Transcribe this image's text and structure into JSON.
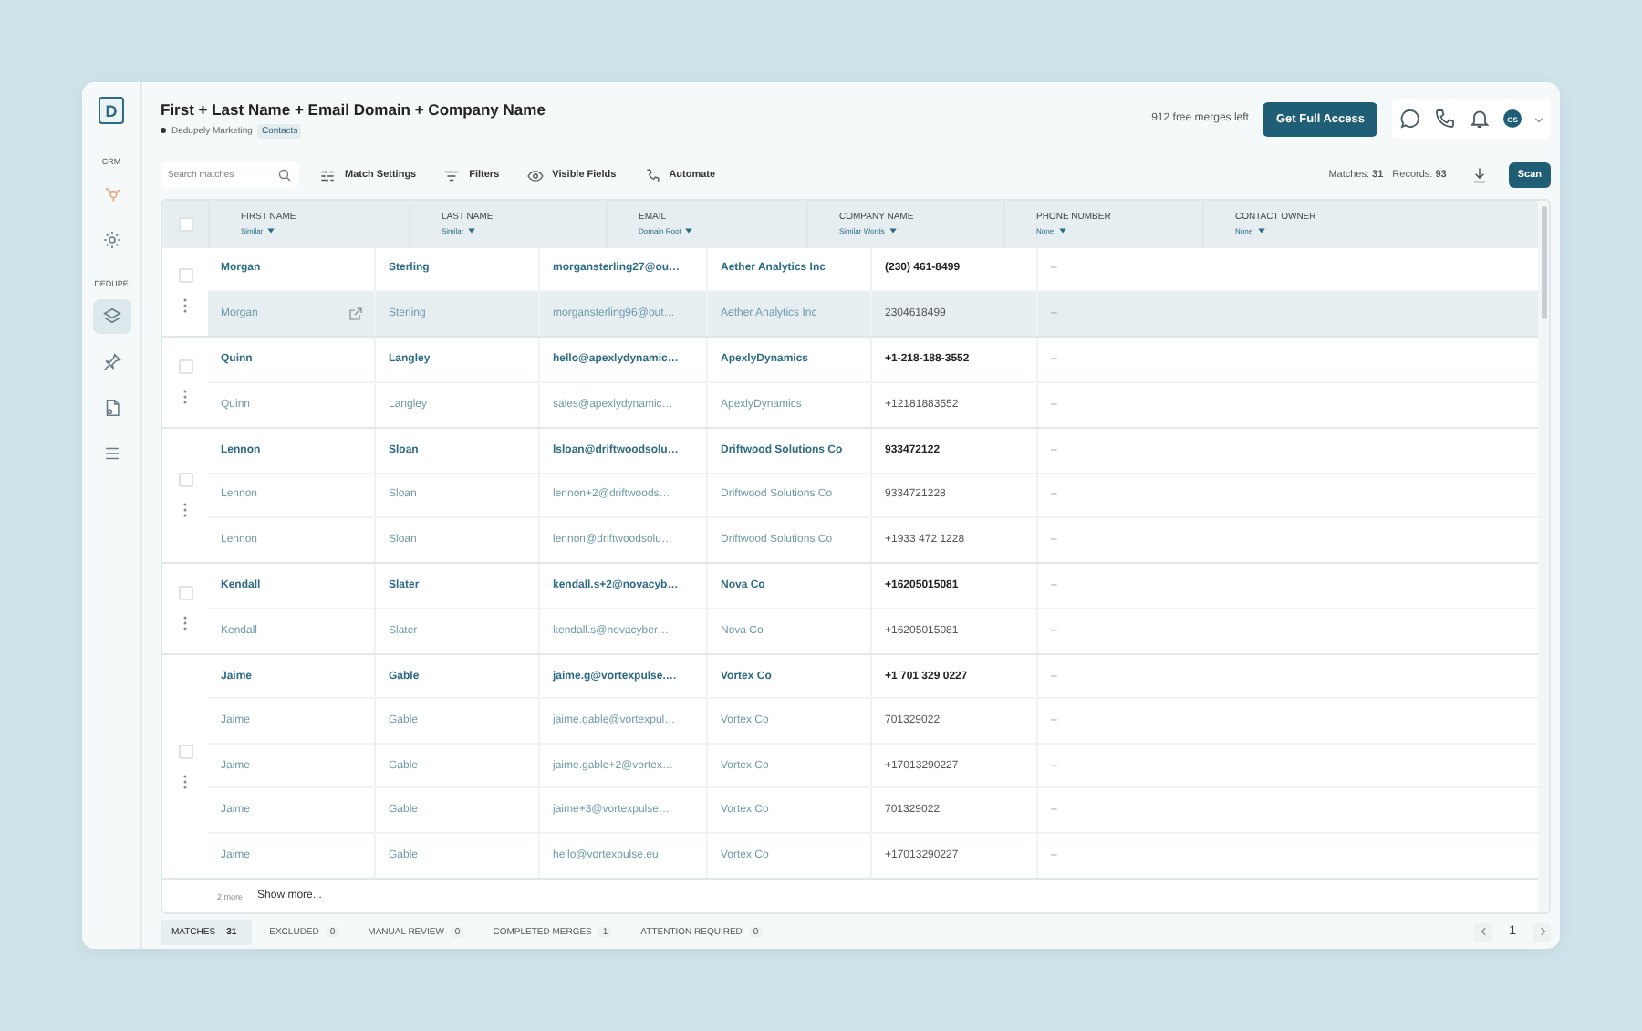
{
  "sidebar": {
    "sections": [
      {
        "label": "CRM",
        "items": [
          {
            "selected": false
          }
        ]
      },
      {
        "items": [
          {
            "selected": false
          }
        ]
      },
      {
        "label": "DEDUPE",
        "items": [
          {
            "selected": true
          },
          {
            "selected": false
          },
          {
            "selected": false
          },
          {
            "selected": false
          }
        ]
      }
    ]
  },
  "header": {
    "logo": "D",
    "title": "First + Last Name + Email Domain + Company Name",
    "account": "Dedupely Marketing",
    "object": "Contacts",
    "free_merges": "912 free merges left",
    "cta": "Get Full Access",
    "avatar": "GS"
  },
  "toolbar": {
    "search": {
      "placeholder": "Search matches"
    },
    "actions": [
      "Match Settings",
      "Filters",
      "Visible Fields",
      "Automate"
    ],
    "matches": "Matches: **31**",
    "records": "Records: **93**",
    "scan": "Scan"
  },
  "table": {
    "select_all_checked": false,
    "columns": [
      {
        "name": "FIRST NAME",
        "filter": "Similar"
      },
      {
        "name": "LAST NAME",
        "filter": "Similar"
      },
      {
        "name": "EMAIL",
        "filter": "Domain Root"
      },
      {
        "name": "COMPANY NAME",
        "filter": "Similar Words"
      },
      {
        "name": "PHONE NUMBER",
        "filter": "None"
      },
      {
        "name": "CONTACT OWNER",
        "filter": "None"
      }
    ],
    "groups": [
      {
        "checked": false,
        "rows": [
          {
            "kind": "primary",
            "hovered": false,
            "cells": [
              "Morgan",
              "Sterling",
              "morgansterling27@ou…",
              "Aether Analytics Inc",
              "(230) 461-8499",
              "–"
            ]
          },
          {
            "kind": "duplicate",
            "hovered": true,
            "cells": [
              "Morgan",
              "Sterling",
              "morgansterling96@out…",
              "Aether Analytics Inc",
              "2304618499",
              "–"
            ]
          }
        ]
      },
      {
        "checked": false,
        "rows": [
          {
            "kind": "primary",
            "hovered": false,
            "cells": [
              "Quinn",
              "Langley",
              "hello@apexlydynamic…",
              "ApexlyDynamics",
              "+1-218-188-3552",
              "–"
            ]
          },
          {
            "kind": "duplicate",
            "hovered": false,
            "cells": [
              "Quinn",
              "Langley",
              "sales@apexlydynamic…",
              "ApexlyDynamics",
              "+12181883552",
              "–"
            ]
          }
        ]
      },
      {
        "checked": false,
        "rows": [
          {
            "kind": "primary",
            "hovered": false,
            "cells": [
              "Lennon",
              "Sloan",
              "lsloan@driftwoodsolu…",
              "Driftwood Solutions Co",
              "933472122",
              "–"
            ]
          },
          {
            "kind": "duplicate",
            "hovered": false,
            "cells": [
              "Lennon",
              "Sloan",
              "lennon+2@driftwoods…",
              "Driftwood Solutions Co",
              "9334721228",
              "–"
            ]
          },
          {
            "kind": "duplicate",
            "hovered": false,
            "cells": [
              "Lennon",
              "Sloan",
              "lennon@driftwoodsolu…",
              "Driftwood Solutions Co",
              "+1933 472 1228",
              "–"
            ]
          }
        ]
      },
      {
        "checked": false,
        "rows": [
          {
            "kind": "primary",
            "hovered": false,
            "cells": [
              "Kendall",
              "Slater",
              "kendall.s+2@novacyb…",
              "Nova Co",
              "+16205015081",
              "–"
            ]
          },
          {
            "kind": "duplicate",
            "hovered": false,
            "cells": [
              "Kendall",
              "Slater",
              "kendall.s@novacyber…",
              "Nova Co",
              "+16205015081",
              "–"
            ]
          }
        ]
      },
      {
        "checked": false,
        "rows": [
          {
            "kind": "primary",
            "hovered": false,
            "cells": [
              "Jaime",
              "Gable",
              "jaime.g@vortexpulse.…",
              "Vortex Co",
              "+1 701 329 0227",
              "–"
            ]
          },
          {
            "kind": "duplicate",
            "hovered": false,
            "cells": [
              "Jaime",
              "Gable",
              "jaime.gable@vortexpul…",
              "Vortex Co",
              "701329022",
              "–"
            ]
          },
          {
            "kind": "duplicate",
            "hovered": false,
            "cells": [
              "Jaime",
              "Gable",
              "jaime.gable+2@vortex…",
              "Vortex Co",
              "+17013290227",
              "–"
            ]
          },
          {
            "kind": "duplicate",
            "hovered": false,
            "cells": [
              "Jaime",
              "Gable",
              "jaime+3@vortexpulse…",
              "Vortex Co",
              "701329022",
              "–"
            ]
          },
          {
            "kind": "duplicate",
            "hovered": false,
            "cells": [
              "Jaime",
              "Gable",
              "hello@vortexpulse.eu",
              "Vortex Co",
              "+17013290227",
              "–"
            ]
          }
        ]
      }
    ],
    "more_count": "2 more",
    "show_more": "Show more..."
  },
  "tabs": [
    {
      "label": "MATCHES",
      "count": "31",
      "selected": true
    },
    {
      "label": "EXCLUDED",
      "count": "0",
      "selected": false
    },
    {
      "label": "MANUAL REVIEW",
      "count": "0",
      "selected": false
    },
    {
      "label": "COMPLETED MERGES",
      "count": "1",
      "selected": false
    },
    {
      "label": "ATTENTION REQUIRED",
      "count": "0",
      "selected": false
    }
  ],
  "pagination": {
    "page": "1"
  }
}
